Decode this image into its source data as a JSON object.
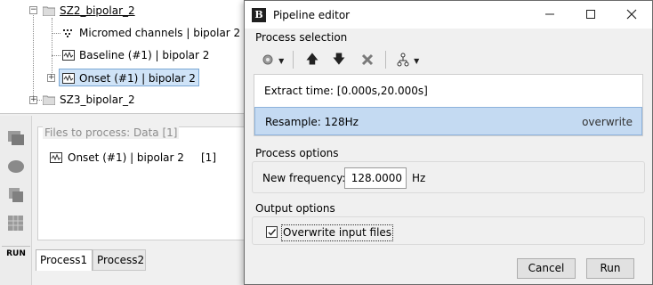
{
  "background": {
    "tree": {
      "items": [
        {
          "label": "SZ2_bipolar_2",
          "icon": "folder-icon"
        },
        {
          "label": "Micromed channels  | bipolar 2",
          "icon": "channels-icon"
        },
        {
          "label": "Baseline (#1) | bipolar 2",
          "icon": "signal-icon"
        },
        {
          "label": "Onset (#1) | bipolar 2",
          "icon": "signal-icon"
        },
        {
          "label": "SZ3_bipolar_2",
          "icon": "folder-icon"
        }
      ]
    },
    "files_panel": {
      "title": "Files to process: Data [1]",
      "row_label": "Onset (#1) | bipolar 2",
      "row_count": "[1]"
    },
    "run_label": "RUN",
    "tabs": [
      "Process1",
      "Process2"
    ]
  },
  "dialog": {
    "title": "Pipeline editor",
    "app_icon_text": "B",
    "process_selection_label": "Process selection",
    "processes": [
      {
        "label": "Extract time: [0.000s,20.000s]",
        "flag": ""
      },
      {
        "label": "Resample: 128Hz",
        "flag": "overwrite"
      }
    ],
    "process_options_label": "Process options",
    "new_frequency_label": "New frequency:",
    "new_frequency_value": "128.0000",
    "new_frequency_unit": "Hz",
    "output_options_label": "Output options",
    "overwrite_checkbox_label": "Overwrite input files",
    "overwrite_checked": true,
    "cancel_label": "Cancel",
    "run_label": "Run"
  },
  "colors": {
    "selection_bg": "#c4daf2",
    "selection_border": "#8db2dc"
  }
}
